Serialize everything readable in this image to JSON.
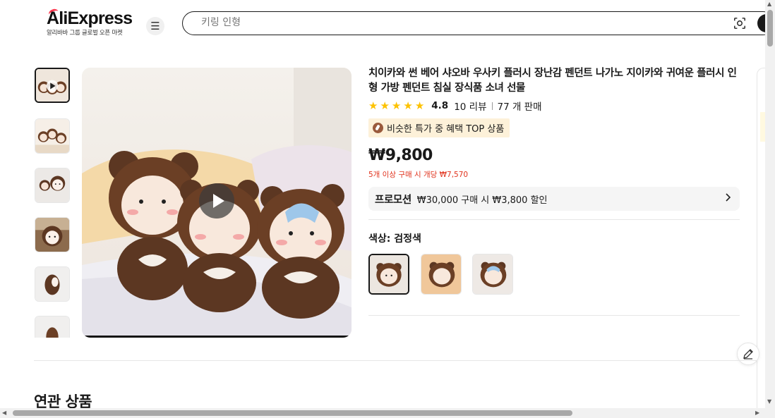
{
  "header": {
    "logo_text": "AliExpress",
    "logo_subtitle": "알리바바 그룹 글로벌 오픈 마켓",
    "search_placeholder": "키링 인형"
  },
  "product": {
    "title": "치이카와 썬 베어 샤오바 우사키 플러시 장난감 펜던트 나가노 지이카와 귀여운 플러시 인형 가방 펜던트 침실 장식품 소녀 선물",
    "rating": "4.8",
    "stars": 5,
    "reviews": "10 리뷰",
    "sold": "77 개 판매",
    "badge": "비슷한 특가 중 혜택 TOP 상품",
    "price": "₩9,800",
    "bulk_price": "5개 이상 구매 시 개당 ₩7,570",
    "promo_label": "프로모션",
    "promo_text": "₩30,000 구매 시 ₩3,800 할인",
    "color_label": "색상: 검정색"
  },
  "sections": {
    "related_title": "연관 상품"
  },
  "colors": {
    "accent": "#fd384f",
    "price_red": "#e0321c",
    "star": "#fdc200",
    "badge_bg": "#fdf1d9"
  },
  "icons": {
    "menu": "menu-icon",
    "camera": "camera-search-icon",
    "play": "play-icon",
    "arrow": "chevron-right-icon",
    "edit": "edit-icon"
  }
}
